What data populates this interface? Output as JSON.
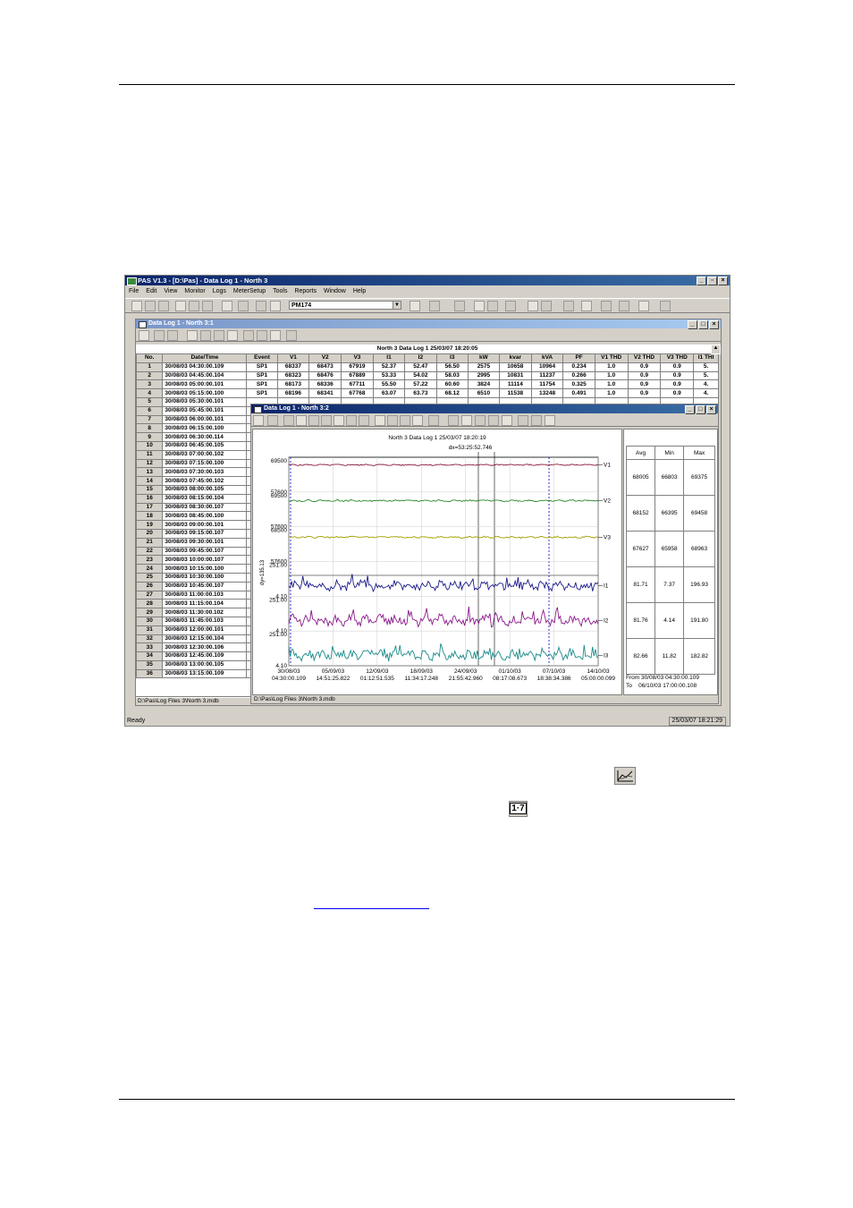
{
  "app": {
    "title": "PAS V1.3 - [D:\\Pas] - Data Log 1 - North 3",
    "menu": [
      "File",
      "Edit",
      "View",
      "Monitor",
      "Logs",
      "MeterSetup",
      "Tools",
      "Reports",
      "Window",
      "Help"
    ],
    "device_combo": "PM174",
    "status_left": "Ready",
    "status_right": "25/03/07 18:21:29"
  },
  "log_window": {
    "title": "Data Log 1 - North 3:1",
    "table_title": "North 3  Data Log 1  25/03/07 18:20:05",
    "columns": [
      "No.",
      "Date/Time",
      "Event",
      "V1",
      "V2",
      "V3",
      "I1",
      "I2",
      "I3",
      "kW",
      "kvar",
      "kVA",
      "PF",
      "V1 THD",
      "V2 THD",
      "V3 THD",
      "I1 THI"
    ],
    "rows": [
      [
        "1",
        "30/08/03 04:30:00.109",
        "SP1",
        "68337",
        "68473",
        "67919",
        "52.37",
        "52.47",
        "56.50",
        "2575",
        "10658",
        "10964",
        "0.234",
        "1.0",
        "0.9",
        "0.9",
        "5."
      ],
      [
        "2",
        "30/08/03 04:45:00.104",
        "SP1",
        "68323",
        "68476",
        "67889",
        "53.33",
        "54.02",
        "58.03",
        "2995",
        "10831",
        "11237",
        "0.266",
        "1.0",
        "0.9",
        "0.9",
        "5."
      ],
      [
        "3",
        "30/08/03 05:00:00.101",
        "SP1",
        "68173",
        "68336",
        "67711",
        "55.50",
        "57.22",
        "60.60",
        "3824",
        "11114",
        "11754",
        "0.325",
        "1.0",
        "0.9",
        "0.9",
        "4."
      ],
      [
        "4",
        "30/08/03 05:15:00.100",
        "SP1",
        "68196",
        "68341",
        "67768",
        "63.07",
        "63.73",
        "68.12",
        "6510",
        "11538",
        "13248",
        "0.491",
        "1.0",
        "0.9",
        "0.9",
        "4."
      ],
      [
        "5",
        "30/08/03 05:30:00.101"
      ],
      [
        "6",
        "30/08/03 05:45:00.101"
      ],
      [
        "7",
        "30/08/03 06:00:00.101"
      ],
      [
        "8",
        "30/08/03 06:15:00.100"
      ],
      [
        "9",
        "30/08/03 06:30:00.114"
      ],
      [
        "10",
        "30/08/03 06:45:00.105"
      ],
      [
        "11",
        "30/08/03 07:00:00.102"
      ],
      [
        "12",
        "30/08/03 07:15:00.100"
      ],
      [
        "13",
        "30/08/03 07:30:00.103"
      ],
      [
        "14",
        "30/08/03 07:45:00.102"
      ],
      [
        "15",
        "30/08/03 08:00:00.105"
      ],
      [
        "16",
        "30/08/03 08:15:00.104"
      ],
      [
        "17",
        "30/08/03 08:30:00.107"
      ],
      [
        "18",
        "30/08/03 08:45:00.100"
      ],
      [
        "19",
        "30/08/03 09:00:00.101"
      ],
      [
        "20",
        "30/08/03 09:15:00.107"
      ],
      [
        "21",
        "30/08/03 09:30:00.101"
      ],
      [
        "22",
        "30/08/03 09:45:00.107"
      ],
      [
        "23",
        "30/08/03 10:00:00.107"
      ],
      [
        "24",
        "30/08/03 10:15:00.100"
      ],
      [
        "25",
        "30/08/03 10:30:00.100"
      ],
      [
        "26",
        "30/08/03 10:45:00.107"
      ],
      [
        "27",
        "30/08/03 11:00:00.103"
      ],
      [
        "28",
        "30/08/03 11:15:00.104"
      ],
      [
        "29",
        "30/08/03 11:30:00.102"
      ],
      [
        "30",
        "30/08/03 11:45:00.103"
      ],
      [
        "31",
        "30/08/03 12:00:00.101"
      ],
      [
        "32",
        "30/08/03 12:15:00.104"
      ],
      [
        "33",
        "30/08/03 12:30:00.106"
      ],
      [
        "34",
        "30/08/03 12:45:00.109"
      ],
      [
        "35",
        "30/08/03 13:00:00.105"
      ],
      [
        "36",
        "30/08/03 13:15:00.109"
      ]
    ],
    "status_path": "D:\\Pas\\Log Files 3\\North 3.mdb"
  },
  "graph_window": {
    "title": "Data Log 1 - North 3:2",
    "chart_title": "North 3  Data Log 1  25/03/07 18:20:19",
    "cursor_label": "dx=53:25:52.746",
    "status_path": "D:\\Pas\\Log Files 3\\North 3.mdb",
    "dy_label": "dy=135.13",
    "stats_headers": [
      "Avg",
      "Min",
      "Max"
    ],
    "from_label": "From 30/08/03 04:30:00.109",
    "to_label": "To    06/10/03 17:00:00.108"
  },
  "chart_data": {
    "type": "line",
    "title": "North 3  Data Log 1  25/03/07 18:20:19",
    "x_ticks": [
      {
        "date": "30/08/03",
        "time": "04:30:00.109"
      },
      {
        "date": "05/09/03",
        "time": "14:51:25.822"
      },
      {
        "date": "12/09/03",
        "time": "01:12:51.535"
      },
      {
        "date": "18/09/03",
        "time": "11:34:17.248"
      },
      {
        "date": "24/09/03",
        "time": "21:55:42.960"
      },
      {
        "date": "01/10/03",
        "time": "08:17:08.673"
      },
      {
        "date": "07/10/03",
        "time": "18:38:34.386"
      },
      {
        "date": "14/10/03",
        "time": "05:00:00.099"
      }
    ],
    "series": [
      {
        "name": "V1",
        "color": "#8b1a3a",
        "ymax_label": "69500",
        "ymin_label": "57600",
        "level": 0.78,
        "noise": 0.03,
        "stats": [
          "68005",
          "66803",
          "69375"
        ]
      },
      {
        "name": "V2",
        "color": "#2a8a2a",
        "ymax_label": "69500",
        "ymin_label": "57600",
        "level": 0.75,
        "noise": 0.04,
        "stats": [
          "68152",
          "66395",
          "69458"
        ]
      },
      {
        "name": "V3",
        "color": "#a0a000",
        "ymax_label": "68500",
        "ymin_label": "57600",
        "level": 0.7,
        "noise": 0.04,
        "stats": [
          "67627",
          "65958",
          "68963"
        ]
      },
      {
        "name": "I1",
        "color": "#1a1a8a",
        "ymax_label": "251.00",
        "ymin_label": "4.10",
        "level": 0.3,
        "noise": 0.22,
        "stats": [
          "81.71",
          "7.37",
          "196.93"
        ]
      },
      {
        "name": "I2",
        "color": "#8a1a8a",
        "ymax_label": "251.00",
        "ymin_label": "4.10",
        "level": 0.3,
        "noise": 0.24,
        "stats": [
          "81.76",
          "4.14",
          "191.80"
        ]
      },
      {
        "name": "I3",
        "color": "#1a8a8a",
        "ymax_label": "251.00",
        "ymin_label": "4.10",
        "level": 0.3,
        "noise": 0.22,
        "stats": [
          "82.66",
          "11.82",
          "182.82"
        ]
      }
    ]
  }
}
